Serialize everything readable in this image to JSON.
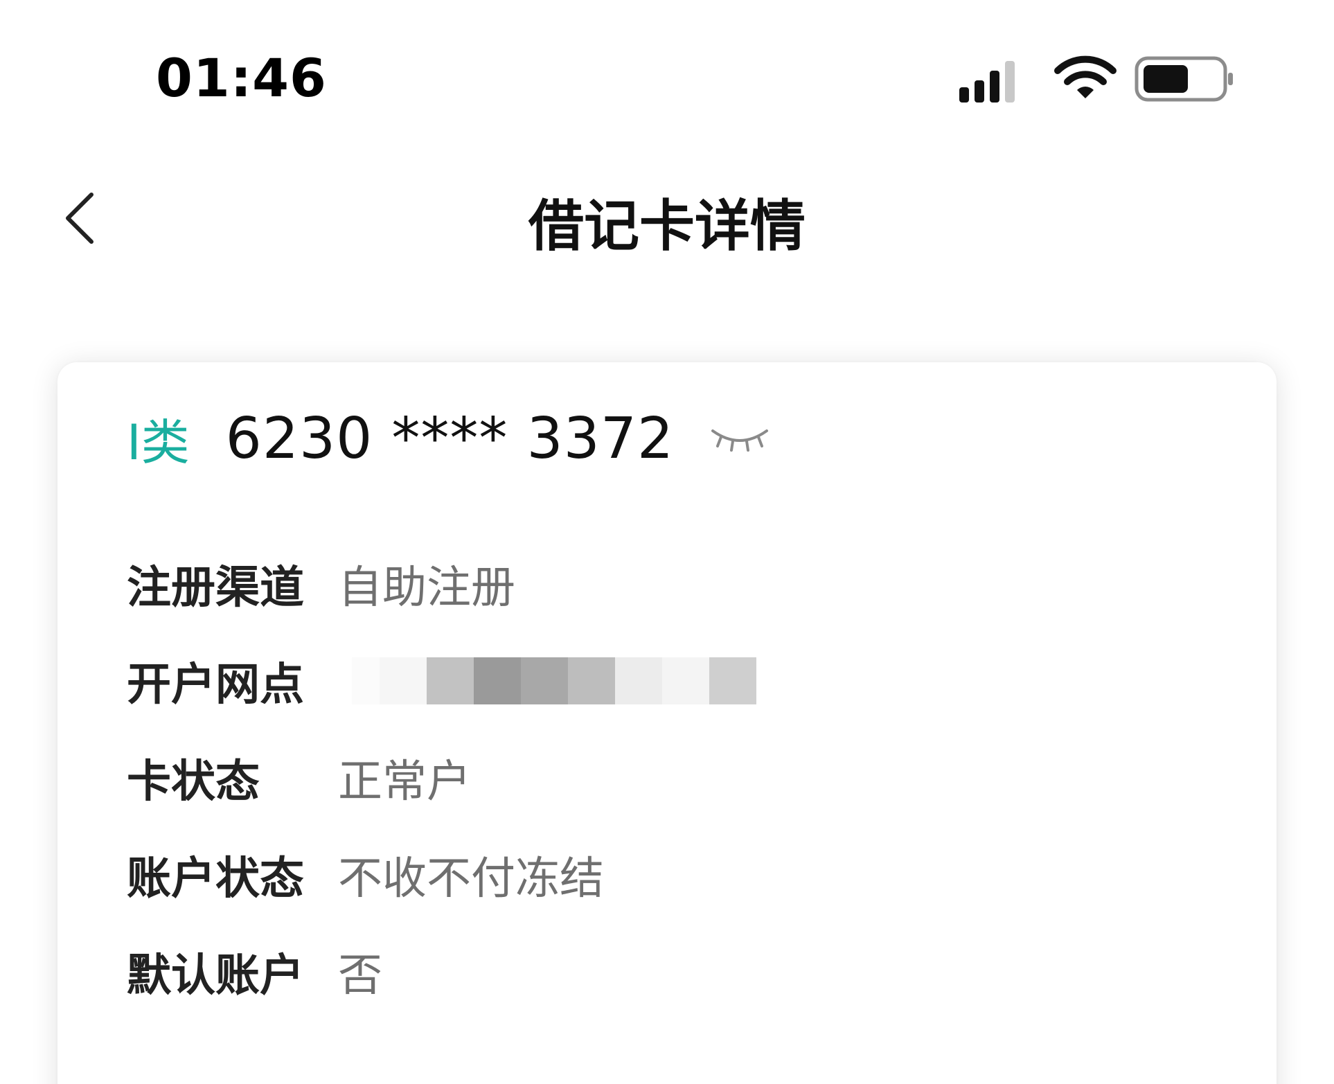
{
  "status_bar": {
    "time": "01:46",
    "signal_icon": "cellular-signal-icon",
    "wifi_icon": "wifi-icon",
    "battery_icon": "battery-icon",
    "battery_level": 0.55
  },
  "nav": {
    "back_icon": "chevron-left-icon",
    "title": "借记卡详情"
  },
  "card": {
    "class_label": "I类",
    "card_number": "6230 **** 3372",
    "visibility_icon": "eye-closed-icon",
    "accent_color": "#1aae9f",
    "details": [
      {
        "label": "注册渠道",
        "value": "自助注册"
      },
      {
        "label": "开户网点",
        "value": ""
      },
      {
        "label": "卡状态",
        "value": "正常户"
      },
      {
        "label": "账户状态",
        "value": "不收不付冻结"
      },
      {
        "label": "默认账户",
        "value": "否"
      }
    ]
  }
}
